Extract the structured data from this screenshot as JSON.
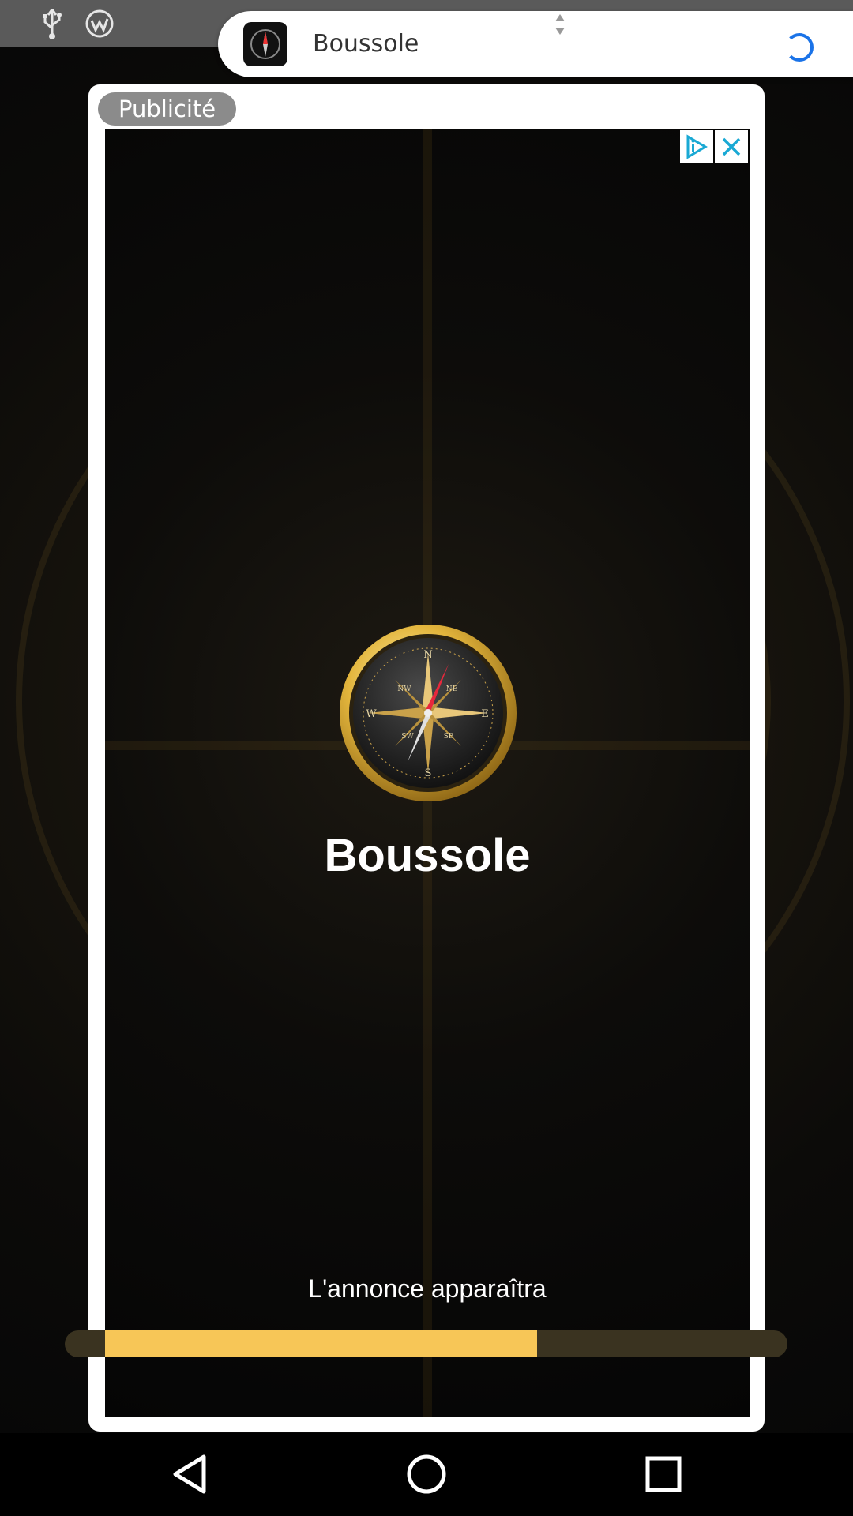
{
  "notification": {
    "app_name": "Boussole"
  },
  "ad": {
    "label": "Publicité",
    "app_title": "Boussole",
    "loading_text": "L'annonce apparaîtra",
    "progress": 0.67,
    "compass": {
      "north": "N",
      "south": "S",
      "east": "E",
      "west": "W",
      "northwest": "NW",
      "northeast": "NE",
      "southwest": "SW",
      "southeast": "SE"
    }
  },
  "colors": {
    "accent": "#f7c657",
    "spinner": "#1a73e8",
    "adchoices": "#1aa9d4"
  },
  "icons": {
    "status_left": [
      "usb-icon",
      "app-notification-icon"
    ],
    "nav": [
      "back-icon",
      "home-icon",
      "recents-icon"
    ]
  }
}
